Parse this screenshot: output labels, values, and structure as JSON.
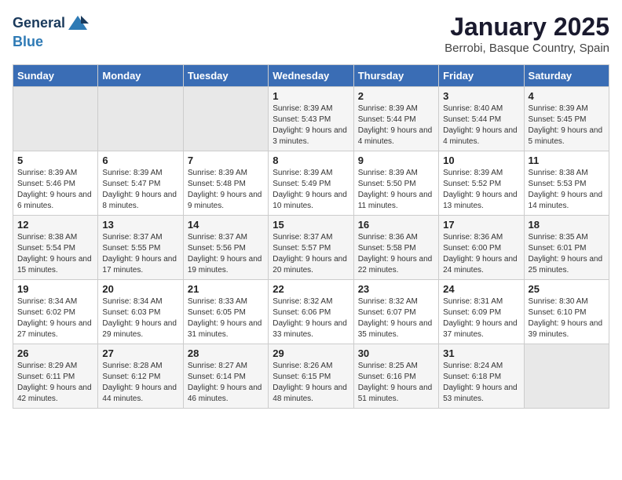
{
  "header": {
    "logo_general": "General",
    "logo_blue": "Blue",
    "title": "January 2025",
    "subtitle": "Berrobi, Basque Country, Spain"
  },
  "weekdays": [
    "Sunday",
    "Monday",
    "Tuesday",
    "Wednesday",
    "Thursday",
    "Friday",
    "Saturday"
  ],
  "weeks": [
    [
      {
        "day": "",
        "sunrise": "",
        "sunset": "",
        "daylight": ""
      },
      {
        "day": "",
        "sunrise": "",
        "sunset": "",
        "daylight": ""
      },
      {
        "day": "",
        "sunrise": "",
        "sunset": "",
        "daylight": ""
      },
      {
        "day": "1",
        "sunrise": "Sunrise: 8:39 AM",
        "sunset": "Sunset: 5:43 PM",
        "daylight": "Daylight: 9 hours and 3 minutes."
      },
      {
        "day": "2",
        "sunrise": "Sunrise: 8:39 AM",
        "sunset": "Sunset: 5:44 PM",
        "daylight": "Daylight: 9 hours and 4 minutes."
      },
      {
        "day": "3",
        "sunrise": "Sunrise: 8:40 AM",
        "sunset": "Sunset: 5:44 PM",
        "daylight": "Daylight: 9 hours and 4 minutes."
      },
      {
        "day": "4",
        "sunrise": "Sunrise: 8:39 AM",
        "sunset": "Sunset: 5:45 PM",
        "daylight": "Daylight: 9 hours and 5 minutes."
      }
    ],
    [
      {
        "day": "5",
        "sunrise": "Sunrise: 8:39 AM",
        "sunset": "Sunset: 5:46 PM",
        "daylight": "Daylight: 9 hours and 6 minutes."
      },
      {
        "day": "6",
        "sunrise": "Sunrise: 8:39 AM",
        "sunset": "Sunset: 5:47 PM",
        "daylight": "Daylight: 9 hours and 8 minutes."
      },
      {
        "day": "7",
        "sunrise": "Sunrise: 8:39 AM",
        "sunset": "Sunset: 5:48 PM",
        "daylight": "Daylight: 9 hours and 9 minutes."
      },
      {
        "day": "8",
        "sunrise": "Sunrise: 8:39 AM",
        "sunset": "Sunset: 5:49 PM",
        "daylight": "Daylight: 9 hours and 10 minutes."
      },
      {
        "day": "9",
        "sunrise": "Sunrise: 8:39 AM",
        "sunset": "Sunset: 5:50 PM",
        "daylight": "Daylight: 9 hours and 11 minutes."
      },
      {
        "day": "10",
        "sunrise": "Sunrise: 8:39 AM",
        "sunset": "Sunset: 5:52 PM",
        "daylight": "Daylight: 9 hours and 13 minutes."
      },
      {
        "day": "11",
        "sunrise": "Sunrise: 8:38 AM",
        "sunset": "Sunset: 5:53 PM",
        "daylight": "Daylight: 9 hours and 14 minutes."
      }
    ],
    [
      {
        "day": "12",
        "sunrise": "Sunrise: 8:38 AM",
        "sunset": "Sunset: 5:54 PM",
        "daylight": "Daylight: 9 hours and 15 minutes."
      },
      {
        "day": "13",
        "sunrise": "Sunrise: 8:37 AM",
        "sunset": "Sunset: 5:55 PM",
        "daylight": "Daylight: 9 hours and 17 minutes."
      },
      {
        "day": "14",
        "sunrise": "Sunrise: 8:37 AM",
        "sunset": "Sunset: 5:56 PM",
        "daylight": "Daylight: 9 hours and 19 minutes."
      },
      {
        "day": "15",
        "sunrise": "Sunrise: 8:37 AM",
        "sunset": "Sunset: 5:57 PM",
        "daylight": "Daylight: 9 hours and 20 minutes."
      },
      {
        "day": "16",
        "sunrise": "Sunrise: 8:36 AM",
        "sunset": "Sunset: 5:58 PM",
        "daylight": "Daylight: 9 hours and 22 minutes."
      },
      {
        "day": "17",
        "sunrise": "Sunrise: 8:36 AM",
        "sunset": "Sunset: 6:00 PM",
        "daylight": "Daylight: 9 hours and 24 minutes."
      },
      {
        "day": "18",
        "sunrise": "Sunrise: 8:35 AM",
        "sunset": "Sunset: 6:01 PM",
        "daylight": "Daylight: 9 hours and 25 minutes."
      }
    ],
    [
      {
        "day": "19",
        "sunrise": "Sunrise: 8:34 AM",
        "sunset": "Sunset: 6:02 PM",
        "daylight": "Daylight: 9 hours and 27 minutes."
      },
      {
        "day": "20",
        "sunrise": "Sunrise: 8:34 AM",
        "sunset": "Sunset: 6:03 PM",
        "daylight": "Daylight: 9 hours and 29 minutes."
      },
      {
        "day": "21",
        "sunrise": "Sunrise: 8:33 AM",
        "sunset": "Sunset: 6:05 PM",
        "daylight": "Daylight: 9 hours and 31 minutes."
      },
      {
        "day": "22",
        "sunrise": "Sunrise: 8:32 AM",
        "sunset": "Sunset: 6:06 PM",
        "daylight": "Daylight: 9 hours and 33 minutes."
      },
      {
        "day": "23",
        "sunrise": "Sunrise: 8:32 AM",
        "sunset": "Sunset: 6:07 PM",
        "daylight": "Daylight: 9 hours and 35 minutes."
      },
      {
        "day": "24",
        "sunrise": "Sunrise: 8:31 AM",
        "sunset": "Sunset: 6:09 PM",
        "daylight": "Daylight: 9 hours and 37 minutes."
      },
      {
        "day": "25",
        "sunrise": "Sunrise: 8:30 AM",
        "sunset": "Sunset: 6:10 PM",
        "daylight": "Daylight: 9 hours and 39 minutes."
      }
    ],
    [
      {
        "day": "26",
        "sunrise": "Sunrise: 8:29 AM",
        "sunset": "Sunset: 6:11 PM",
        "daylight": "Daylight: 9 hours and 42 minutes."
      },
      {
        "day": "27",
        "sunrise": "Sunrise: 8:28 AM",
        "sunset": "Sunset: 6:12 PM",
        "daylight": "Daylight: 9 hours and 44 minutes."
      },
      {
        "day": "28",
        "sunrise": "Sunrise: 8:27 AM",
        "sunset": "Sunset: 6:14 PM",
        "daylight": "Daylight: 9 hours and 46 minutes."
      },
      {
        "day": "29",
        "sunrise": "Sunrise: 8:26 AM",
        "sunset": "Sunset: 6:15 PM",
        "daylight": "Daylight: 9 hours and 48 minutes."
      },
      {
        "day": "30",
        "sunrise": "Sunrise: 8:25 AM",
        "sunset": "Sunset: 6:16 PM",
        "daylight": "Daylight: 9 hours and 51 minutes."
      },
      {
        "day": "31",
        "sunrise": "Sunrise: 8:24 AM",
        "sunset": "Sunset: 6:18 PM",
        "daylight": "Daylight: 9 hours and 53 minutes."
      },
      {
        "day": "",
        "sunrise": "",
        "sunset": "",
        "daylight": ""
      }
    ]
  ]
}
